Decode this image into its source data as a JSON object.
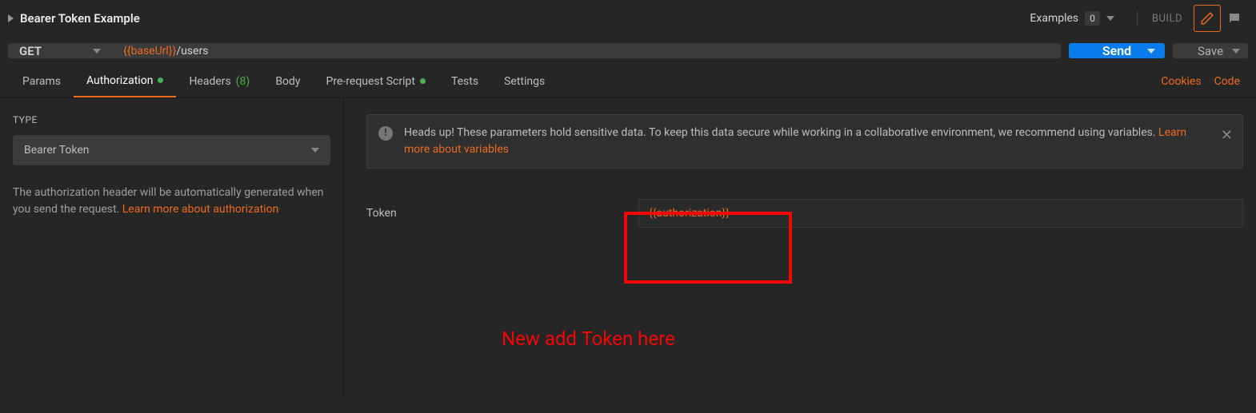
{
  "header": {
    "title": "Bearer Token Example",
    "examples_label": "Examples",
    "examples_count": "0",
    "build_label": "BUILD"
  },
  "request": {
    "method": "GET",
    "url_var": "{{baseUrl}}",
    "url_path": "/users",
    "send_label": "Send",
    "save_label": "Save"
  },
  "tabs": {
    "params": "Params",
    "authorization": "Authorization",
    "headers": "Headers",
    "headers_count": "(8)",
    "body": "Body",
    "prerequest": "Pre-request Script",
    "tests": "Tests",
    "settings": "Settings",
    "cookies": "Cookies",
    "code": "Code"
  },
  "auth": {
    "type_label": "TYPE",
    "type_value": "Bearer Token",
    "help_text_1": "The authorization header will be automatically generated when you send the request. ",
    "help_link": "Learn more about authorization"
  },
  "alert": {
    "text": "Heads up! These parameters hold sensitive data. To keep this data secure while working in a collaborative environment, we recommend using variables. ",
    "link": "Learn more about variables"
  },
  "token": {
    "label": "Token",
    "value": "{{authorization}}"
  },
  "annotation": "New add Token here"
}
